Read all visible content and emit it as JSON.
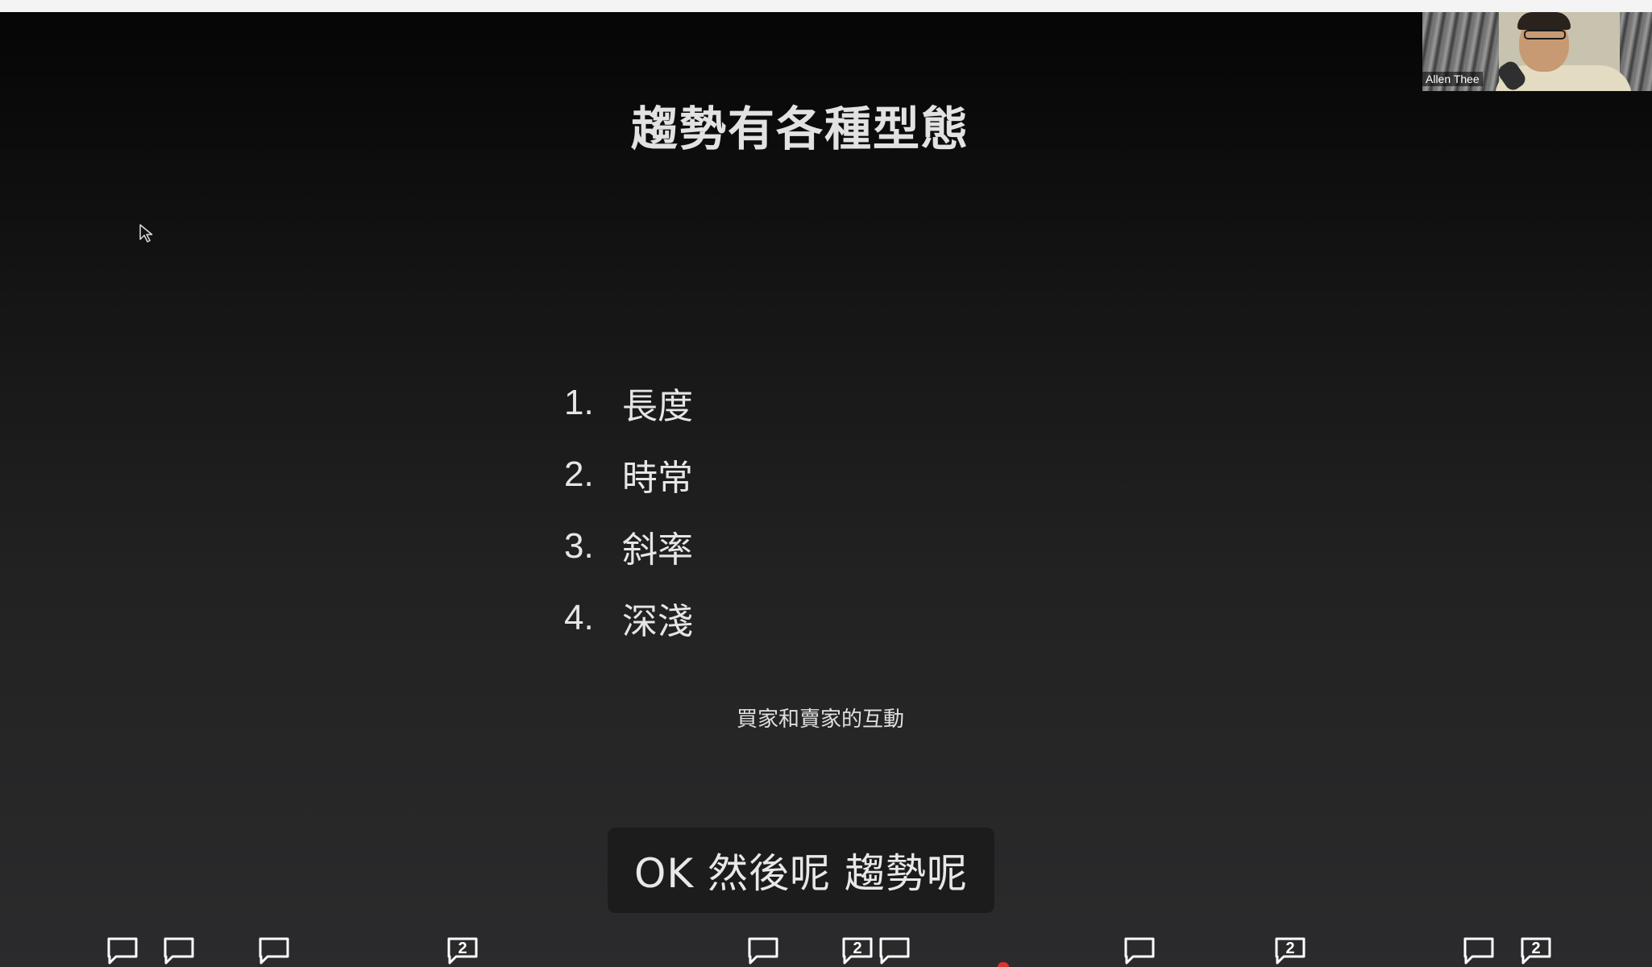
{
  "slide": {
    "title": "趨勢有各種型態",
    "items": [
      {
        "num": "1.",
        "text": "長度"
      },
      {
        "num": "2.",
        "text": "時常"
      },
      {
        "num": "3.",
        "text": "斜率"
      },
      {
        "num": "4.",
        "text": "深淺"
      }
    ],
    "note": "買家和賣家的互動"
  },
  "caption": {
    "text": "OK 然後呢 趨勢呢"
  },
  "participant": {
    "name": "Allen Thee"
  },
  "comment_markers": [
    {
      "count": ""
    },
    {
      "count": ""
    },
    {
      "count": ""
    },
    {
      "count": "2"
    },
    {
      "count": ""
    },
    {
      "count": "2"
    },
    {
      "count": ""
    },
    {
      "count": ""
    },
    {
      "count": "2"
    },
    {
      "count": ""
    },
    {
      "count": "2"
    }
  ],
  "colors": {
    "background_top": "#050505",
    "background_bottom": "#2b2b2d",
    "text": "#e2e2e2",
    "caption_bg": "#1c1c1c",
    "marker_red": "#e03030"
  }
}
